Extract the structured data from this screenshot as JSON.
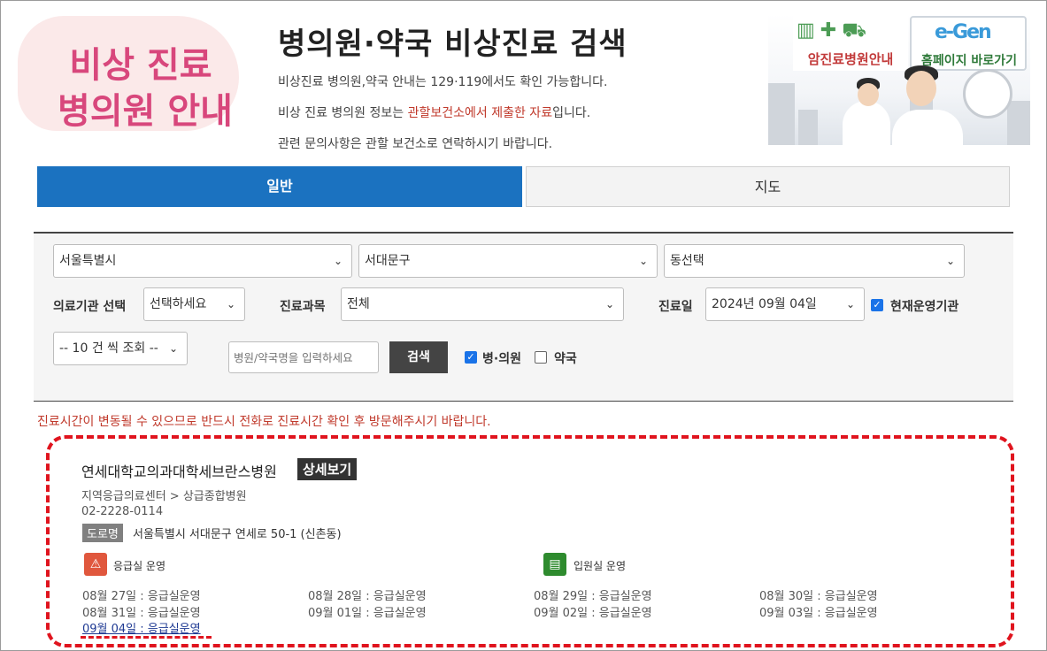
{
  "header": {
    "logo_line1": "비상 진료",
    "logo_line2": "병의원 안내",
    "title": "병의원·약국 비상진료 검색",
    "info_line1": "비상진료 병의원,약국 안내는 129·119에서도 확인 가능합니다.",
    "info_line2_pre": "비상 진료 병의원 정보는 ",
    "info_line2_red": "관할보건소에서 제출한 자료",
    "info_line2_post": "입니다.",
    "info_line3": "관련 문의사항은 관할 보건소로 연락하시기 바랍니다."
  },
  "banner": {
    "cancer_label": "암진료병원안내",
    "homepage_label": "홈페이지 바로가기",
    "homepage_logo": "e-Gen",
    "icons": [
      "hospital-building-icon",
      "medicine-kit-icon",
      "ambulance-icon"
    ]
  },
  "tabs": [
    {
      "label": "일반",
      "active": true
    },
    {
      "label": "지도",
      "active": false
    }
  ],
  "search": {
    "city": "서울특별시",
    "district": "서대문구",
    "dong": "동선택",
    "institution_label": "의료기관 선택",
    "institution_value": "선택하세요",
    "dept_label": "진료과목",
    "dept_value": "전체",
    "date_label": "진료일",
    "date_value": "2024년 09월 04일",
    "operating_label": "현재운영기관",
    "operating_checked": true,
    "per_page": "-- 10 건 씩 조회 --",
    "name_placeholder": "병원/약국명을 입력하세요",
    "search_button": "검색",
    "hospital_label": "병·의원",
    "hospital_checked": true,
    "pharmacy_label": "약국",
    "pharmacy_checked": false
  },
  "notice": "진료시간이 변동될 수 있으므로 반드시 전화로 진료시간 확인 후 방문해주시기 바랍니다.",
  "result": {
    "name": "연세대학교의과대학세브란스병원",
    "detail_button": "상세보기",
    "category": "지역응급의료센터 > 상급종합병원",
    "phone": "02-2228-0114",
    "road_label": "도로명",
    "address": "서울특별시 서대문구 연세로 50-1 (신촌동)",
    "er_status": "응급실 운영",
    "ward_status": "입원실 운영",
    "er_color": "#e0573d",
    "ward_color": "#2e8b2e",
    "schedule": [
      "08월 27일 : 응급실운영",
      "08월 28일 : 응급실운영",
      "08월 29일 : 응급실운영",
      "08월 30일 : 응급실운영",
      "08월 31일 : 응급실운영",
      "09월 01일 : 응급실운영",
      "09월 02일 : 응급실운영",
      "09월 03일 : 응급실운영"
    ],
    "today": "09월 04일 : 응급실운영"
  },
  "colors": {
    "tab_active": "#1b72c0",
    "logo_pink": "#d8477c",
    "notice_red": "#c0392b",
    "highlight_dash": "#e0141e"
  }
}
